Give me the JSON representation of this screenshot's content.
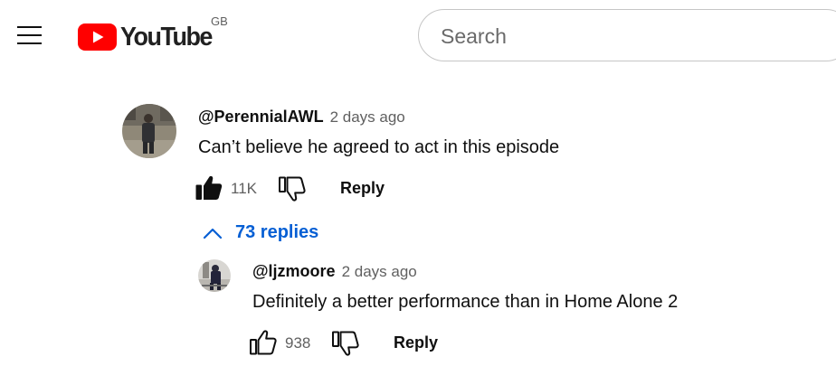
{
  "header": {
    "logo_text": "YouTube",
    "country_code": "GB",
    "search_placeholder": "Search"
  },
  "comment": {
    "author": "@PerennialAWL",
    "time": "2 days ago",
    "text": "Can’t believe he agreed to act in this episode",
    "likes": "11K",
    "liked": true,
    "reply_label": "Reply",
    "replies_label": "73 replies"
  },
  "reply": {
    "author": "@ljzmoore",
    "time": "2 days ago",
    "text": "Definitely a better performance than in Home Alone 2",
    "likes": "938",
    "liked": false,
    "reply_label": "Reply"
  },
  "colors": {
    "brand_red": "#ff0000",
    "link_blue": "#065fd4",
    "text_primary": "#0f0f0f",
    "text_secondary": "#606060"
  }
}
